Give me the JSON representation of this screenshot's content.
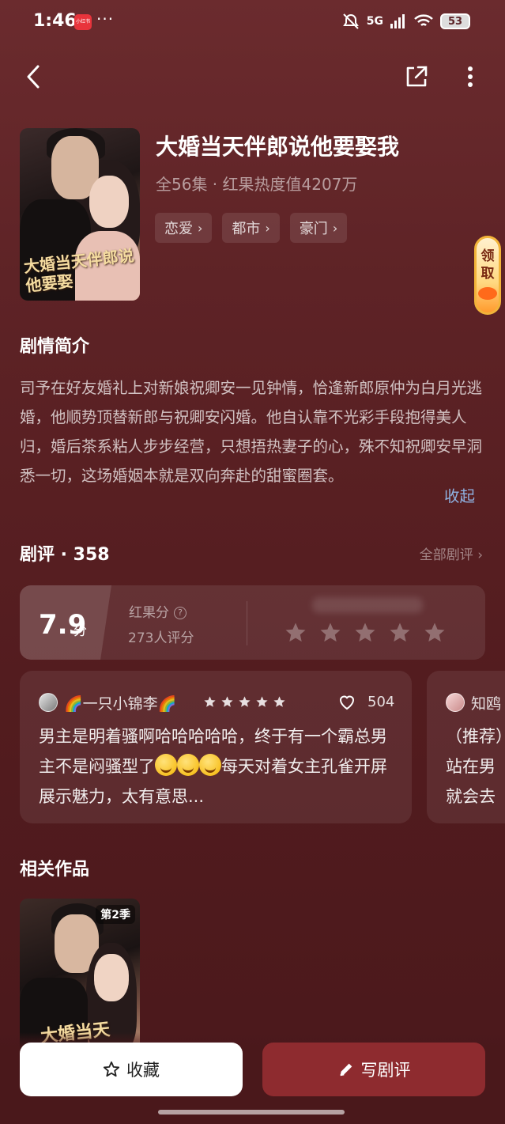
{
  "status": {
    "time": "1:46",
    "app_badge": "小红书",
    "dots": "···",
    "network": "5G",
    "battery": "53"
  },
  "drama": {
    "title": "大婚当天伴郎说他要娶我",
    "meta": "全56集 · 红果热度值4207万",
    "cover_title": "大婚当天伴郎说他要娶",
    "tags": [
      "恋爱",
      "都市",
      "豪门"
    ]
  },
  "claim": {
    "line1": "领",
    "line2": "取"
  },
  "synopsis": {
    "heading": "剧情简介",
    "text": "司予在好友婚礼上对新娘祝卿安一见钟情，恰逢新郎原仲为白月光逃婚，他顺势顶替新郎与祝卿安闪婚。他自认靠不光彩手段抱得美人归，婚后茶系粘人步步经营，只想捂热妻子的心，殊不知祝卿安早洞悉一切，这场婚姻本就是双向奔赴的甜蜜圈套。",
    "collapse_label": "收起"
  },
  "reviews": {
    "heading": "剧评 · 358",
    "all_label": "全部剧评 ›",
    "score": "7.9",
    "score_unit": "分",
    "score_label": "红果分",
    "rating_count": "273人评分",
    "items": [
      {
        "user": "🌈一只小锦李🌈",
        "stars": 5,
        "likes": "504",
        "text_part1": "男主是明着骚啊哈哈哈哈哈，终于有一个霸总男主不是闷骚型了",
        "text_part2": "每天对着女主孔雀开屏展示魅力，太有意思..."
      },
      {
        "user": "知鸥",
        "text": "（推荐）站在男就会去"
      }
    ]
  },
  "related": {
    "heading": "相关作品",
    "season_badge": "第2季",
    "cover_title": "大婚当天"
  },
  "actions": {
    "favorite_label": "收藏",
    "write_review_label": "写剧评"
  },
  "colors": {
    "background": "#5e2326",
    "accent_button": "#8e2b2f",
    "link": "#8fb2e3"
  }
}
